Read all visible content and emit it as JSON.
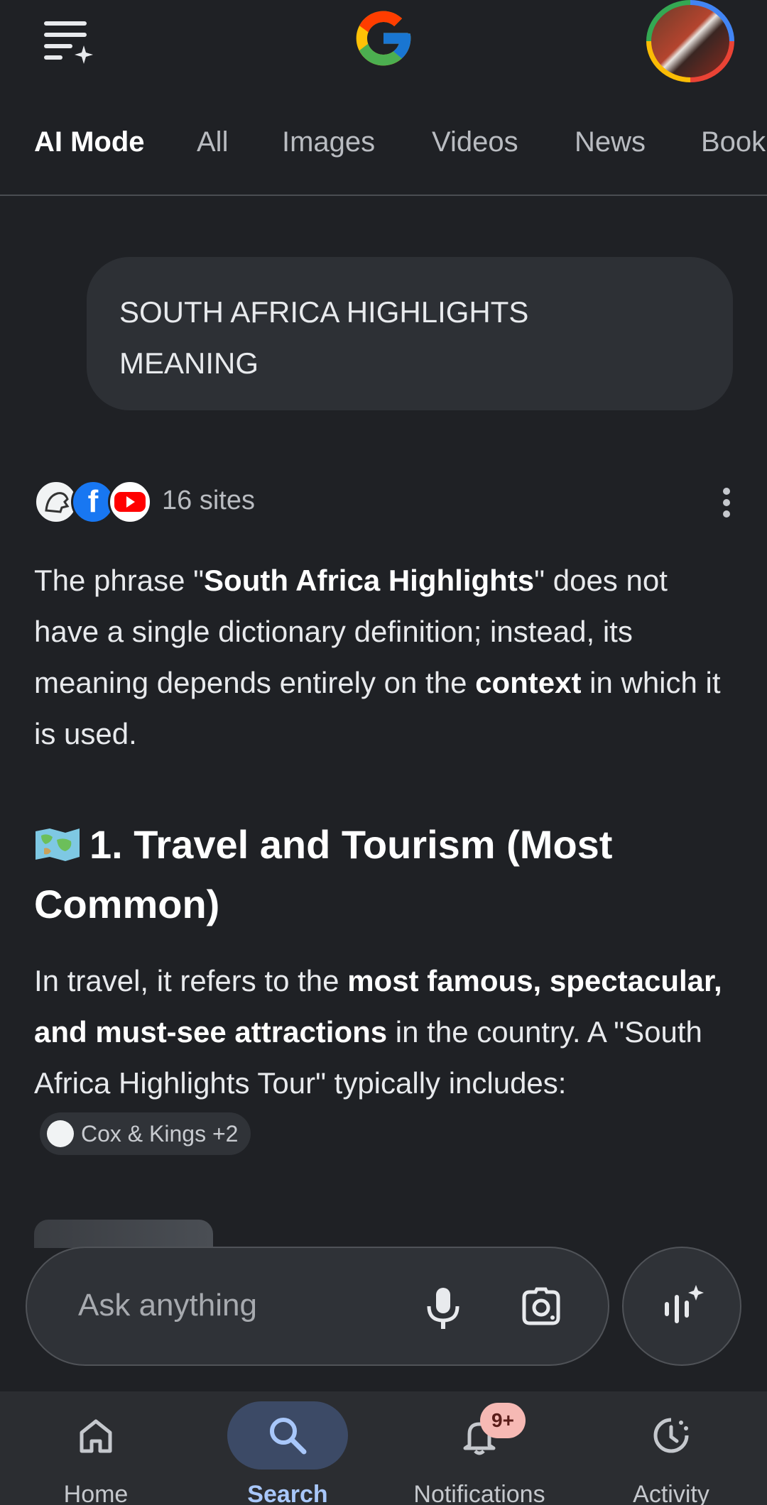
{
  "header": {
    "menu_icon": "menu-sparkle-icon",
    "logo": "google-g-logo",
    "avatar_icon": "profile-avatar"
  },
  "tabs": [
    {
      "label": "AI Mode",
      "active": true
    },
    {
      "label": "All"
    },
    {
      "label": "Images"
    },
    {
      "label": "Videos"
    },
    {
      "label": "News"
    },
    {
      "label": "Book"
    }
  ],
  "query": {
    "text": "SOUTH AFRICA HIGHLIGHTS MEANING"
  },
  "sources": {
    "count_label": "16 sites",
    "icons": [
      "lion-logo-icon",
      "facebook-icon",
      "youtube-icon"
    ]
  },
  "answer": {
    "p1": {
      "t1": "The phrase \"",
      "b1": "South Africa Highlights",
      "t2": "\" does not have a single dictionary definition; instead, its meaning depends entirely on the ",
      "b2": "context",
      "t3": " in which it is used."
    },
    "heading": {
      "emoji": "world-map-icon",
      "text": "1. Travel and Tourism (Most Common)"
    },
    "p2": {
      "t1": "In travel, it refers to the ",
      "b1": "most famous, spectacular, and must-see attractions",
      "t2": " in the country. A \"South Africa Highlights Tour\" typically includes:",
      "chip": "Cox & Kings +2"
    }
  },
  "ask_bar": {
    "placeholder": "Ask anything"
  },
  "bottom_nav": {
    "items": [
      {
        "label": "Home",
        "icon": "home-icon"
      },
      {
        "label": "Search",
        "icon": "search-icon",
        "active": true
      },
      {
        "label": "Notifications",
        "icon": "bell-icon"
      },
      {
        "label": "Activity",
        "icon": "activity-icon"
      }
    ],
    "badge": "9+"
  }
}
